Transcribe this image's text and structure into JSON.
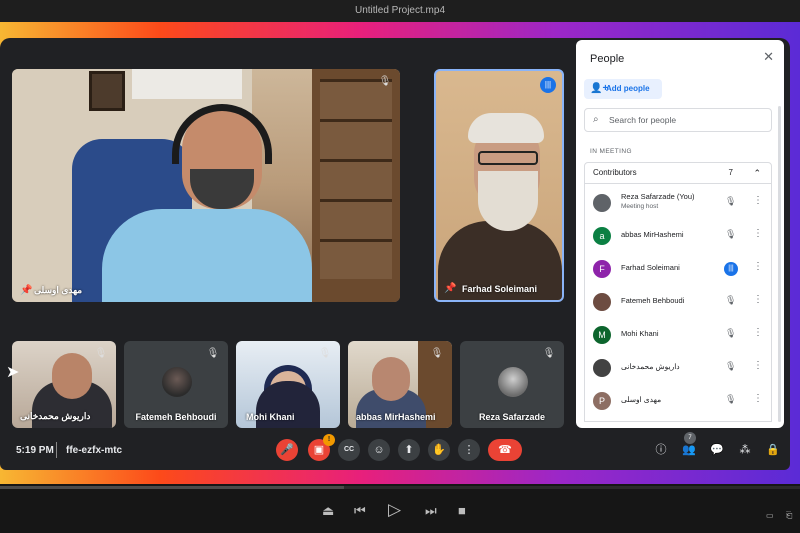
{
  "player": {
    "title": "Untitled Project.mp4",
    "progress_fraction": 0.43,
    "controls": {
      "eject": "⏏",
      "prev": "⏮",
      "play": "▷",
      "next": "⏭",
      "stop": "■",
      "right_a": "▭",
      "right_b": "⎗"
    }
  },
  "meeting": {
    "time": "5:19 PM",
    "code": "ffe-ezfx-mtc",
    "tiles": {
      "main_name": "مهدی اوسلی",
      "farhad_name": "Farhad Soleimani",
      "small": [
        {
          "name": "داریوش محمدخانی"
        },
        {
          "name": "Fatemeh Behboudi"
        },
        {
          "name": "Mohi Khani"
        },
        {
          "name": "abbas MirHashemi"
        },
        {
          "name": "Reza Safarzade"
        }
      ]
    },
    "controls": {
      "mic": "🎤",
      "camera": "▣",
      "camera_badge": "!",
      "captions": "CC",
      "emoji": "☺",
      "present": "⬆",
      "hand": "✋",
      "more": "⋮",
      "end": "☎"
    },
    "side_controls": {
      "info": "ⓘ",
      "people": "👥",
      "people_count": "7",
      "chat": "💬",
      "activities": "⁂",
      "lock": "🔒"
    }
  },
  "people_panel": {
    "title": "People",
    "close": "✕",
    "add_people": "Add people",
    "search_placeholder": "Search for people",
    "section_label": "IN MEETING",
    "group_label": "Contributors",
    "group_count": "7",
    "participants": [
      {
        "name": "Reza Safarzade (You)",
        "sub": "Meeting host",
        "initial": "",
        "color": "#5f6368"
      },
      {
        "name": "abbas MirHashemi",
        "sub": "",
        "initial": "a",
        "color": "#0b8043"
      },
      {
        "name": "Farhad Soleimani",
        "sub": "",
        "initial": "F",
        "color": "#8e24aa"
      },
      {
        "name": "Fatemeh Behboudi",
        "sub": "",
        "initial": "",
        "color": "#6d4c41"
      },
      {
        "name": "Mohi Khani",
        "sub": "",
        "initial": "M",
        "color": "#0d652d"
      },
      {
        "name": "داریوش محمدخانی",
        "sub": "",
        "initial": "",
        "color": "#424242"
      },
      {
        "name": "مهدی اوسلی",
        "sub": "",
        "initial": "P",
        "color": "#8d6e63"
      }
    ],
    "mic_off_icon": "🎙",
    "more_icon": "⋮"
  }
}
